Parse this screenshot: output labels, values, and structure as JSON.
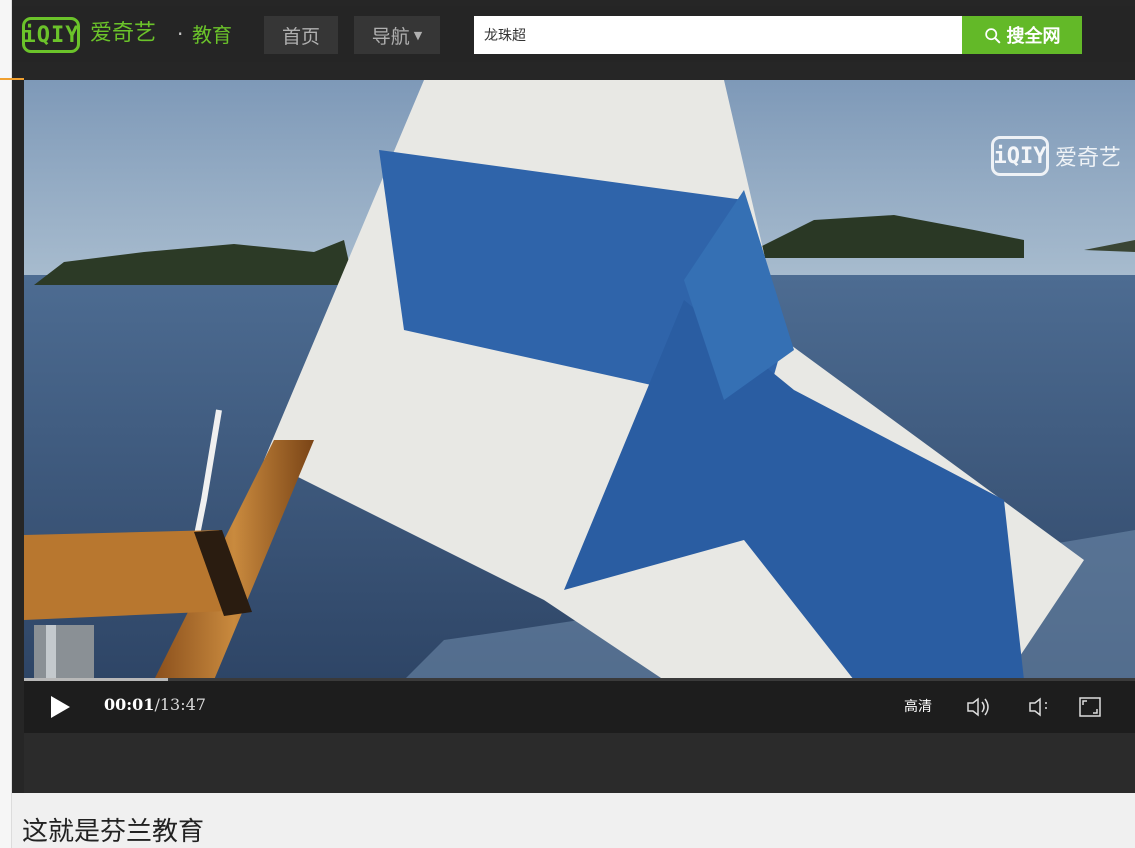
{
  "header": {
    "logo_text": "iQIY",
    "brand_name": "爱奇艺",
    "separator": "·",
    "channel_name": "教育",
    "nav_home": "首页",
    "nav_menu": "导航",
    "search_value": "龙珠超",
    "search_button": "搜全网"
  },
  "player": {
    "watermark_logo": "iQIY",
    "watermark_text": "爱奇艺",
    "current_time": "00:01",
    "time_separator": "/",
    "duration": "13:47",
    "progress_fraction": 0.0012,
    "quality_label": "高清"
  },
  "video": {
    "title": "这就是芬兰教育"
  },
  "colors": {
    "brand_green": "#6bc32a",
    "search_green": "#63b928",
    "bar_bg": "#252525"
  }
}
